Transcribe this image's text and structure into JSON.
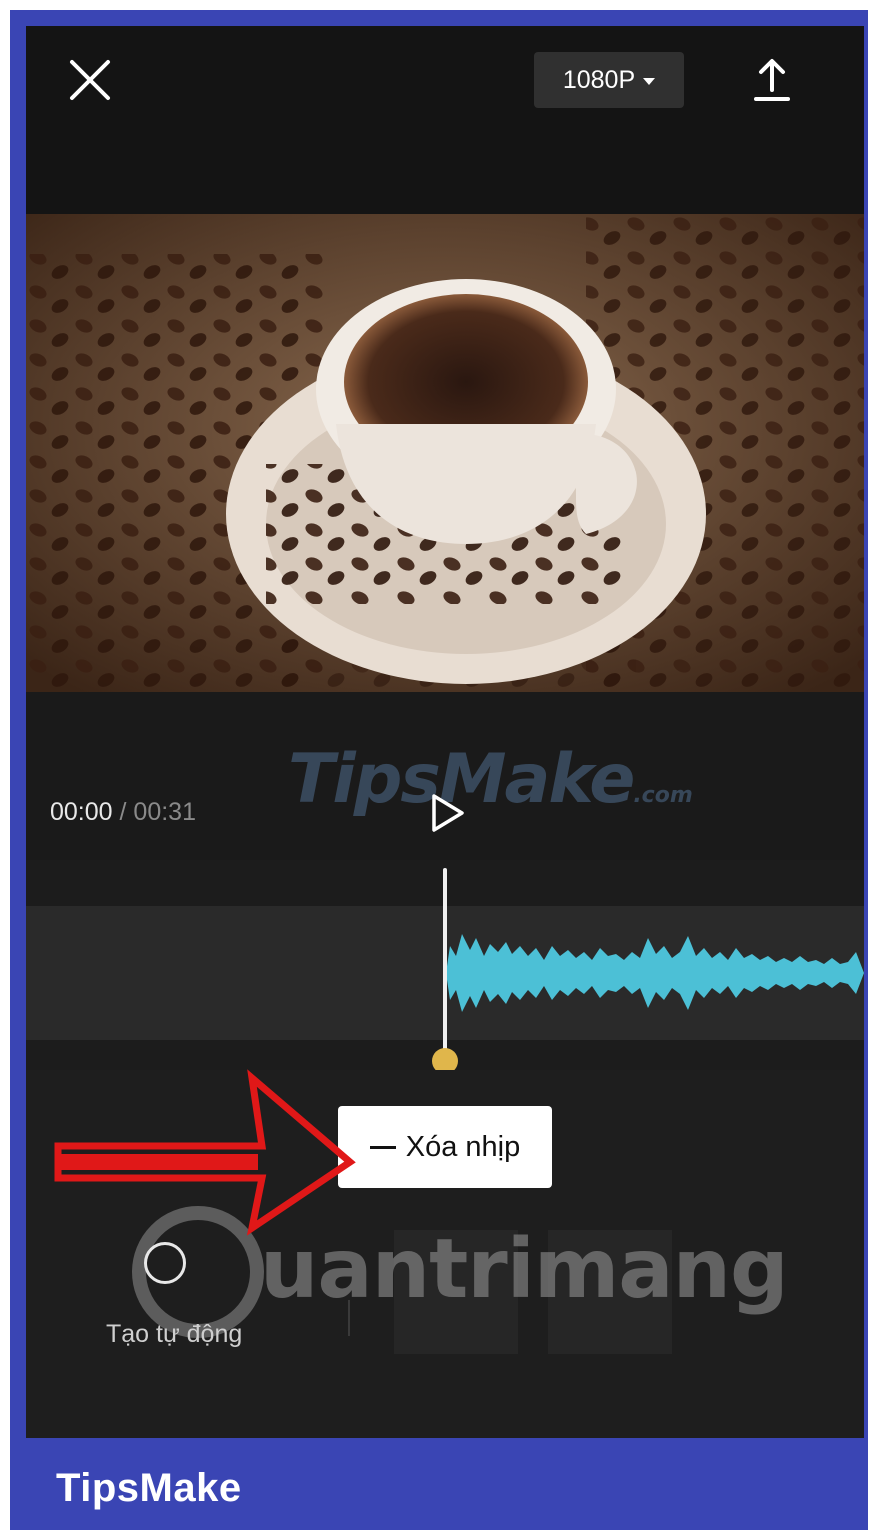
{
  "header": {
    "resolution_label": "1080P",
    "close_icon": "close-icon",
    "export_icon": "export-upload-icon"
  },
  "player": {
    "current_time": "00:00",
    "separator": "/",
    "duration": "00:31",
    "play_icon": "play-icon"
  },
  "watermarks": {
    "top_brand": "TipsMake",
    "top_brand_suffix": ".com",
    "center_brand": "uantrimang"
  },
  "beat": {
    "delete_beat_label": "Xóa nhịp"
  },
  "tools": {
    "auto_label": "Tạo tự động"
  },
  "footer": {
    "brand": "TipsMake"
  },
  "colors": {
    "frame": "#3a45b4",
    "waveform": "#4cc0d6",
    "playhead_knob": "#e0b64b",
    "annotation_arrow": "#e01818"
  }
}
